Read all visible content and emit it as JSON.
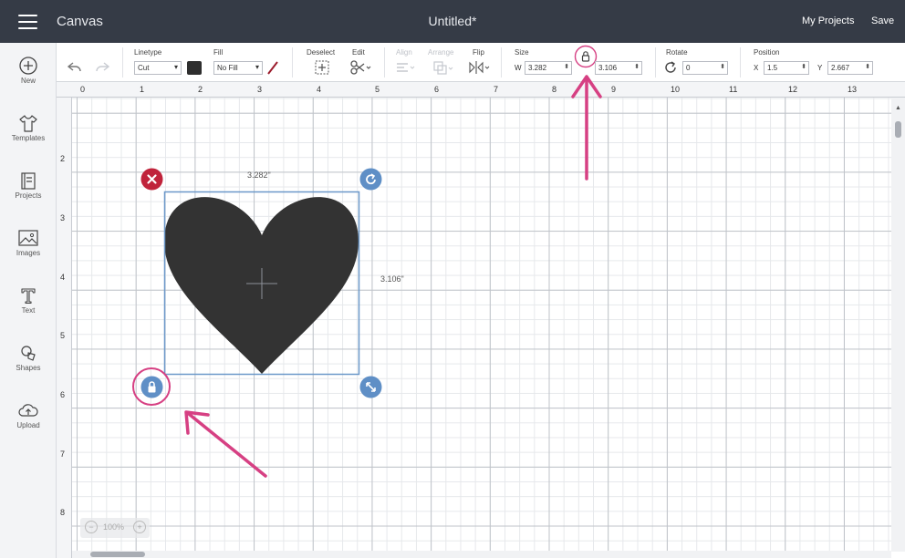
{
  "header": {
    "app_title": "Canvas",
    "document_title": "Untitled*",
    "my_projects_label": "My Projects",
    "save_label": "Save"
  },
  "sidebar": {
    "items": [
      {
        "label": "New",
        "icon": "plus-circle-icon"
      },
      {
        "label": "Templates",
        "icon": "shirt-icon"
      },
      {
        "label": "Projects",
        "icon": "projects-icon"
      },
      {
        "label": "Images",
        "icon": "image-icon"
      },
      {
        "label": "Text",
        "icon": "text-icon"
      },
      {
        "label": "Shapes",
        "icon": "shapes-icon"
      },
      {
        "label": "Upload",
        "icon": "upload-cloud-icon"
      }
    ]
  },
  "toolbar": {
    "linetype_label": "Linetype",
    "linetype_value": "Cut",
    "fill_label": "Fill",
    "fill_value": "No Fill",
    "deselect_label": "Deselect",
    "edit_label": "Edit",
    "align_label": "Align",
    "arrange_label": "Arrange",
    "flip_label": "Flip",
    "size_label": "Size",
    "width_axis": "W",
    "width_value": "3.282",
    "height_value": "3.106",
    "rotate_label": "Rotate",
    "rotate_value": "0",
    "position_label": "Position",
    "x_axis": "X",
    "x_value": "1.5",
    "y_axis": "Y",
    "y_value": "2.667",
    "swatch_color": "#2e2e2e"
  },
  "rulers": {
    "top": [
      "0",
      "1",
      "2",
      "3",
      "4",
      "5",
      "6",
      "7",
      "8",
      "9",
      "10",
      "11",
      "12",
      "13"
    ],
    "left": [
      "2",
      "3",
      "4",
      "5",
      "6",
      "7",
      "8"
    ]
  },
  "selection": {
    "width_label": "3.282\"",
    "height_label": "3.106\"",
    "shape_color": "#333333",
    "box_color": "#6b98c9"
  },
  "zoom": {
    "value": "100%"
  },
  "annotation_color": "#d64083"
}
